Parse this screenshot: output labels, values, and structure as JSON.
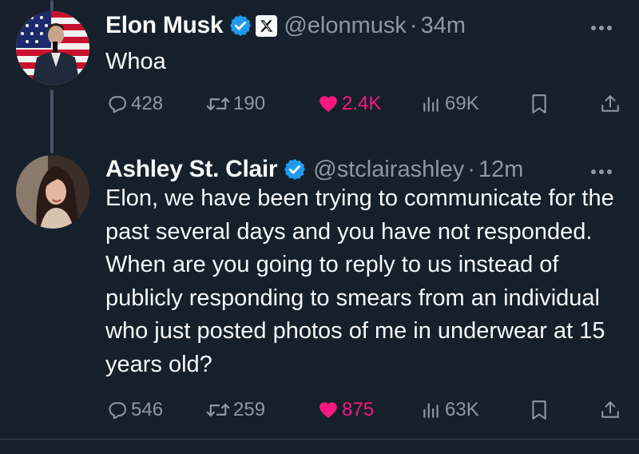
{
  "tweets": [
    {
      "author": {
        "display_name": "Elon Musk",
        "handle": "@elonmusk",
        "verified": true,
        "affiliate_badge": "x-logo-icon",
        "avatar": "avatar-elon-musk-flag-background"
      },
      "time_separator": "·",
      "time": "34m",
      "text": "Whoa",
      "metrics": {
        "replies": "428",
        "retweets": "190",
        "likes": "2.4K",
        "views": "69K"
      },
      "liked": true
    },
    {
      "author": {
        "display_name": "Ashley St. Clair",
        "handle": "@stclairashley",
        "verified": true,
        "avatar": "avatar-ashley-st-clair"
      },
      "time_separator": "·",
      "time": "12m",
      "text": "Elon, we have been trying to communicate for the past several days and you have not responded. When are you going to reply to us instead of publicly responding to smears from an individual who just posted photos of me in underwear at 15 years old?",
      "metrics": {
        "replies": "546",
        "retweets": "259",
        "likes": "875",
        "views": "63K"
      },
      "liked": true
    }
  ],
  "colors": {
    "background": "#15202b",
    "text_primary": "#f7f9f9",
    "text_secondary": "#8b98a5",
    "verified_blue": "#1d9bf0",
    "like_pink": "#f91880",
    "thread_line": "#425364"
  }
}
